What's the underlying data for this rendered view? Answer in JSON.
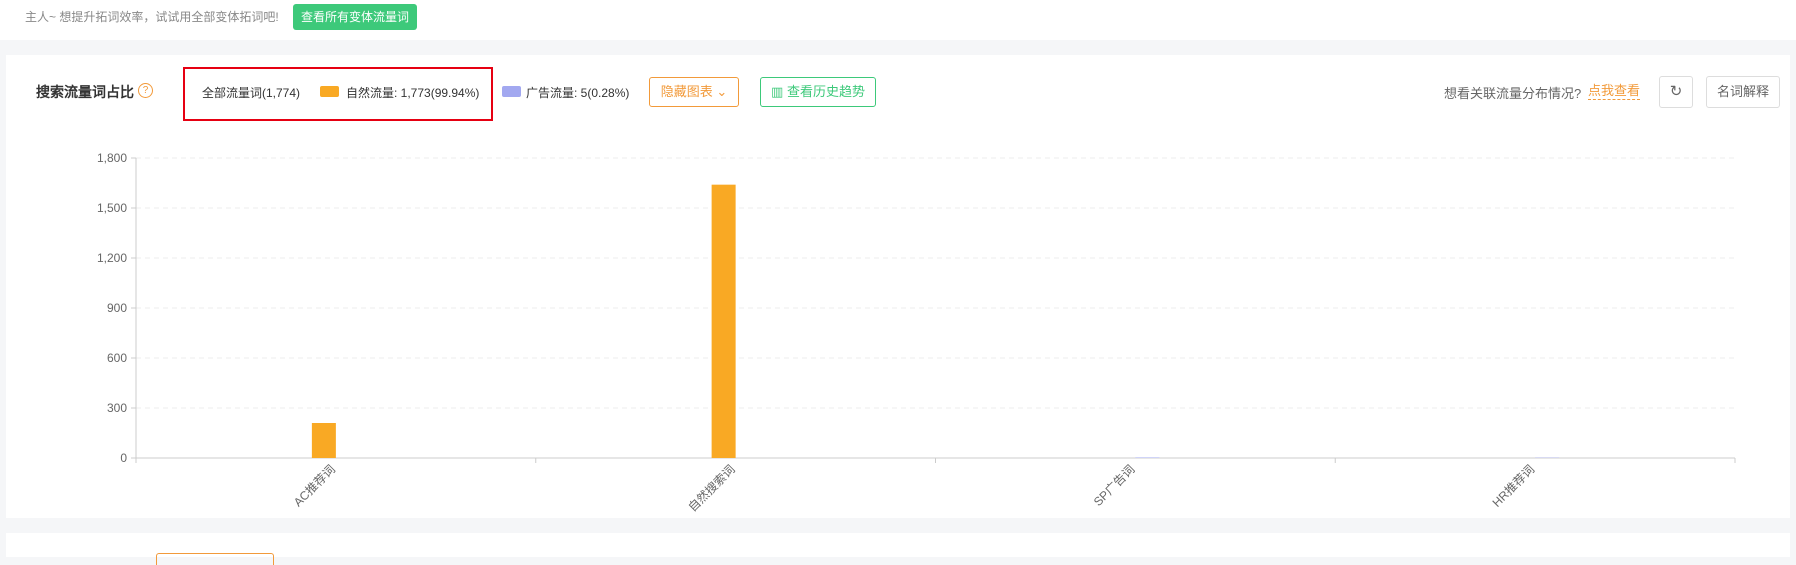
{
  "tip_bar": {
    "text": "主人~ 想提升拓词效率，试试用全部变体拓词吧!",
    "button_label": "查看所有变体流量词"
  },
  "panel": {
    "title": "搜索流量词占比",
    "help_icon": "question-circle-icon",
    "legend": {
      "total": "全部流量词(1,774)",
      "natural": "自然流量: 1,773(99.94%)",
      "ad": "广告流量: 5(0.28%)"
    },
    "hide_button_label": "隐藏图表",
    "history_button_label": "查看历史趋势",
    "want_text": "想看关联流量分布情况?",
    "want_link": "点我查看",
    "glossary_button_label": "名词解释",
    "colors": {
      "natural": "#f9a924",
      "ad": "#a2a8f0",
      "accent_orange": "#f29a3a",
      "accent_green": "#3dc97a",
      "highlight_box": "#e60012"
    }
  },
  "chart_data": {
    "type": "bar",
    "categories": [
      "AC推荐词",
      "自然搜索词",
      "SP广告词",
      "HR推荐词"
    ],
    "series": [
      {
        "name": "自然流量",
        "values": [
          210,
          1640,
          0,
          0
        ]
      },
      {
        "name": "广告流量",
        "values": [
          0,
          0,
          3,
          2
        ]
      }
    ],
    "y_ticks": [
      "0",
      "300",
      "600",
      "900",
      "1,200",
      "1,500",
      "1,800"
    ],
    "ylim": [
      0,
      1800
    ],
    "grid": true
  }
}
